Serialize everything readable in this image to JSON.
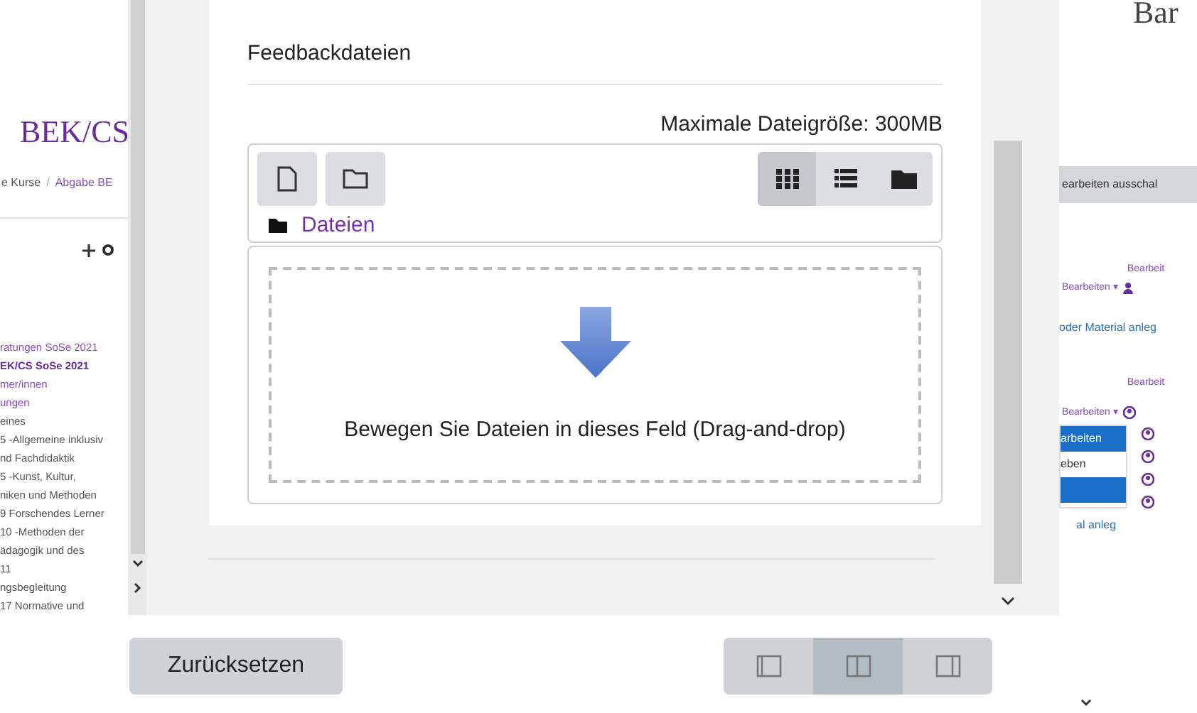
{
  "background_left": {
    "title": "BEK/CS",
    "breadcrumb": [
      "e Kurse",
      "/",
      "Abgabe BE"
    ],
    "nav_items": [
      {
        "text": "ratungen SoSe 2021",
        "kind": "link"
      },
      {
        "text": "EK/CS SoSe 2021",
        "kind": "current"
      },
      {
        "text": "mer/innen",
        "kind": "link"
      },
      {
        "text": "ungen",
        "kind": "link"
      },
      {
        "text": "eines",
        "kind": "plain"
      },
      {
        "text": "5 -Allgemeine inklusiv",
        "kind": "plain"
      },
      {
        "text": "nd Fachdidaktik",
        "kind": "plain"
      },
      {
        "text": "5 -Kunst, Kultur,",
        "kind": "plain"
      },
      {
        "text": "niken und Methoden",
        "kind": "plain"
      },
      {
        "text": "9 Forschendes Lerner",
        "kind": "plain"
      },
      {
        "text": "10 -Methoden der",
        "kind": "plain"
      },
      {
        "text": "ädagogik und des",
        "kind": "plain"
      },
      {
        "text": "11",
        "kind": "plain"
      },
      {
        "text": "ngsbegleitung",
        "kind": "plain"
      },
      {
        "text": "17 Normative und",
        "kind": "plain"
      }
    ]
  },
  "dialog": {
    "section_title": "Feedbackdateien",
    "max_size": "Maximale Dateigröße: 300MB",
    "view_modes": [
      {
        "kind": "grid",
        "selected": true
      },
      {
        "kind": "list",
        "selected": false
      },
      {
        "kind": "tree",
        "selected": false
      }
    ],
    "path": "Dateien",
    "dropzone_text": "Bewegen Sie Dateien in dieses Feld (Drag-and-drop)",
    "reset_button": "Zurücksetzen",
    "layout_buttons": [
      {
        "kind": "left",
        "selected": false
      },
      {
        "kind": "center",
        "selected": true
      },
      {
        "kind": "right",
        "selected": false
      }
    ]
  },
  "background_right": {
    "heading": "Bar",
    "toggle_button": "earbeiten ausschal",
    "edit_label_1": "Bearbeit",
    "edit_menu_1": "Bearbeiten ▾",
    "add_link": "oder Material anleg",
    "edit_label_2": "Bearbeit",
    "edit_menu_2": "Bearbeiten ▾",
    "menu_items": [
      {
        "text": "arbeiten",
        "selected": true
      },
      {
        "text": "eben",
        "selected": false
      },
      {
        "selected": true
      }
    ],
    "add_link_2": "al anleg"
  }
}
